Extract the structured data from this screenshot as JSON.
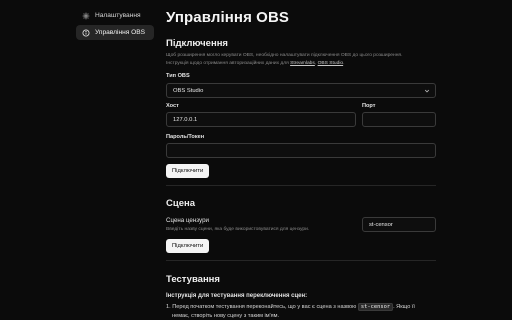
{
  "sidebar": {
    "items": [
      {
        "label": "Налаштування",
        "icon": "gear-icon"
      },
      {
        "label": "Управління OBS",
        "icon": "info-circle-icon"
      }
    ]
  },
  "page": {
    "title": "Управління OBS"
  },
  "connection": {
    "title": "Підключення",
    "desc_line1": "Щоб розширення могло керувати OBS, необхідно налаштувати підключення OBS до цього розширення.",
    "desc_line2_prefix": "Інструкція щодо отримання авторизаційних даних для",
    "link_streamlabs": "Streamlabs",
    "link_obs": "OBS Studio",
    "obs_type_label": "Тип OBS",
    "obs_type_value": "OBS Studio",
    "host_label": "Хост",
    "host_value": "127.0.0.1",
    "port_label": "Порт",
    "port_value": "",
    "password_label": "Пароль/Токен",
    "password_value": "",
    "connect_button": "Підключити"
  },
  "scene": {
    "title": "Сцена",
    "censor_label": "Сцена цензури",
    "censor_desc": "Введіть назву сцени, яка буде використовуватися для цензури.",
    "censor_value": "st-censor",
    "connect_button": "Підключити"
  },
  "testing": {
    "title": "Тестування",
    "instructions_title": "Інструкція для тестування переключення сцен:",
    "step1_prefix": "1. Перед початком тестування переконайтесь, що у вас є сцена з назвою",
    "step1_code": "st-censor",
    "step1_suffix": ". Якщо її",
    "step1_line2": "немає, створіть нову сцену з таким ім'ям."
  }
}
